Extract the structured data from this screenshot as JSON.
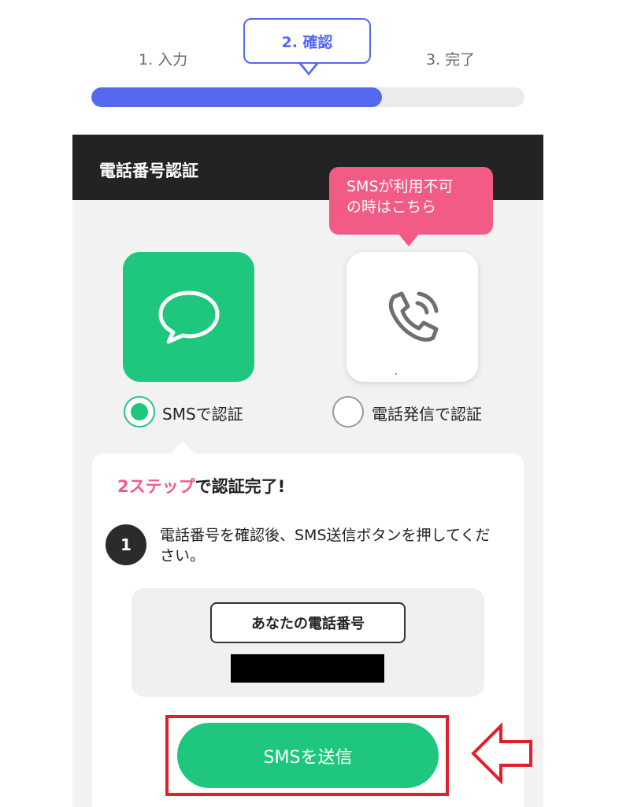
{
  "stepper": {
    "steps": [
      {
        "label": "1. 入力",
        "active": false
      },
      {
        "label": "2. 確認",
        "active": true
      },
      {
        "label": "3. 完了",
        "active": false
      }
    ],
    "progress_fraction": 0.67,
    "colors": {
      "active": "#5468f0",
      "track": "#ebebeb"
    }
  },
  "section": {
    "title": "電話番号認証"
  },
  "tooltip": {
    "line1": "SMSが利用不可",
    "line2": "の時はこちら",
    "color": "#f25b86"
  },
  "options": {
    "sms": {
      "label": "SMSで認証",
      "icon": "chat-bubble-icon",
      "selected": true,
      "color": "#1fc77e"
    },
    "call": {
      "label": "電話発信で認証",
      "icon": "phone-call-icon",
      "selected": false
    }
  },
  "card": {
    "title_highlight": "2ステップ",
    "title_rest": "で認証完了!",
    "step_number": "1",
    "instruction": "電話番号を確認後、SMS送信ボタンを押してください。",
    "phone_label": "あなたの電話番号"
  },
  "send_button": {
    "label": "SMSを送信"
  },
  "annotation": {
    "highlight_color": "#e0202a",
    "pointer": "left-arrow-icon"
  }
}
